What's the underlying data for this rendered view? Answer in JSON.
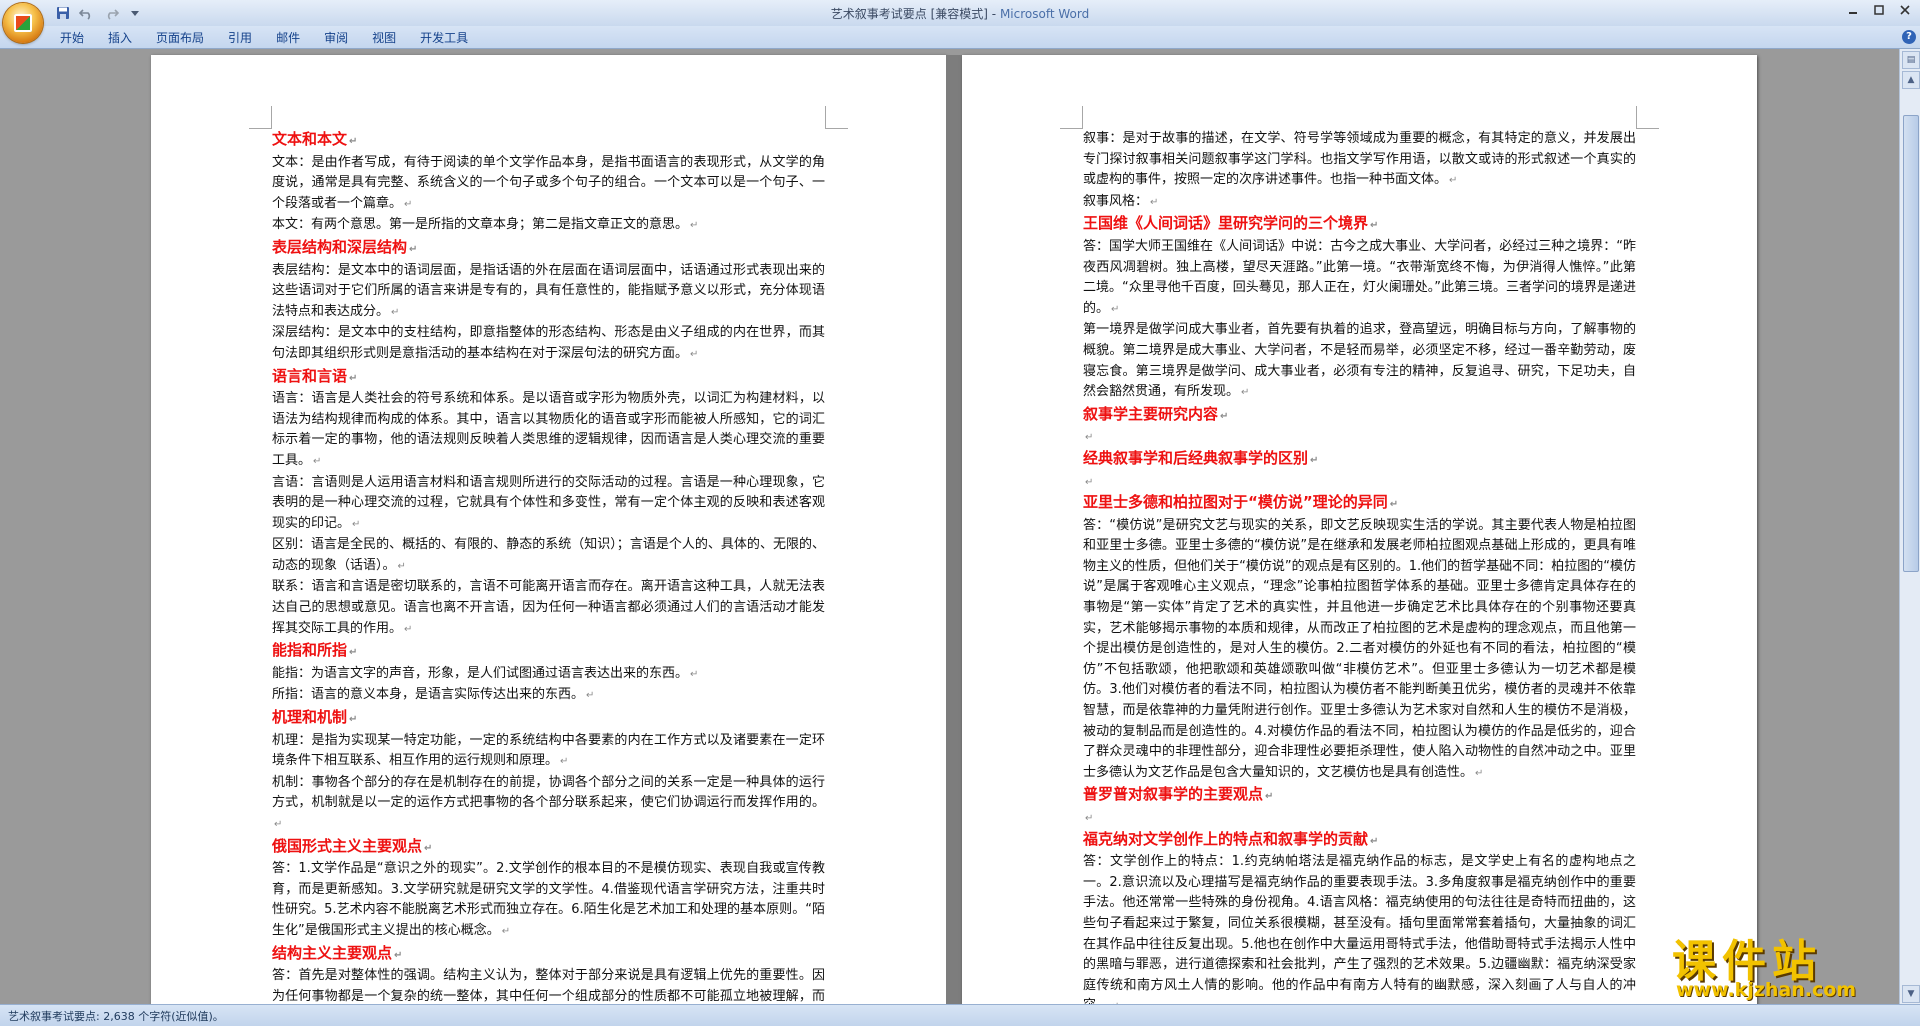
{
  "window": {
    "title": "艺术叙事考试要点 [兼容模式]",
    "separator": " - ",
    "app": "Microsoft Word"
  },
  "ribbon": {
    "tabs": [
      "开始",
      "插入",
      "页面布局",
      "引用",
      "邮件",
      "审阅",
      "视图",
      "开发工具"
    ]
  },
  "colors": {
    "heading": "#ee1111",
    "ribbon_text": "#15428b"
  },
  "icons": [
    "office-button-icon",
    "save-icon",
    "undo-icon",
    "redo-icon",
    "customize-qat-icon",
    "minimize-icon",
    "maximize-icon",
    "close-icon",
    "help-icon"
  ],
  "status": {
    "text": "艺术叙事考试要点: 2,638 个字符(近似值)。"
  },
  "watermark": {
    "title": "课件站",
    "url": "www.kjzhan.com"
  },
  "page1": [
    {
      "h": "文本和本文"
    },
    {
      "p": "文本：是由作者写成，有待于阅读的单个文学作品本身，是指书面语言的表现形式，从文学的角度说，通常是具有完整、系统含义的一个句子或多个句子的组合。一个文本可以是一个句子、一个段落或者一个篇章。"
    },
    {
      "p": "本文：有两个意思。第一是所指的文章本身；第二是指文章正文的意思。"
    },
    {
      "h": "表层结构和深层结构"
    },
    {
      "p": "表层结构：是文本中的语词层面，是指话语的外在层面在语词层面中，话语通过形式表现出来的这些语词对于它们所属的语言来讲是专有的，具有任意性的，能指赋予意义以形式，充分体现语法特点和表达成分。"
    },
    {
      "p": "深层结构：是文本中的支柱结构，即意指整体的形态结构、形态是由义子组成的内在世界，而其句法即其组织形式则是意指活动的基本结构在对于深层句法的研究方面。"
    },
    {
      "h": "语言和言语"
    },
    {
      "p": "语言：语言是人类社会的符号系统和体系。是以语音或字形为物质外壳，以词汇为构建材料，以语法为结构规律而构成的体系。其中，语言以其物质化的语音或字形而能被人所感知，它的词汇标示着一定的事物，他的语法规则反映着人类思维的逻辑规律，因而语言是人类心理交流的重要工具。"
    },
    {
      "p": "言语：言语则是人运用语言材料和语言规则所进行的交际活动的过程。言语是一种心理现象，它表明的是一种心理交流的过程，它就具有个体性和多变性，常有一定个体主观的反映和表述客观现实的印记。"
    },
    {
      "p": "区别：语言是全民的、概括的、有限的、静态的系统（知识）；言语是个人的、具体的、无限的、动态的现象（话语）。"
    },
    {
      "p": "联系：语言和言语是密切联系的，言语不可能离开语言而存在。离开语言这种工具，人就无法表达自己的思想或意见。语言也离不开言语，因为任何一种语言都必须通过人们的言语活动才能发挥其交际工具的作用。"
    },
    {
      "h": "能指和所指"
    },
    {
      "p": "能指：为语言文字的声音，形象，是人们试图通过语言表达出来的东西。"
    },
    {
      "p": "所指：语言的意义本身，是语言实际传达出来的东西。"
    },
    {
      "h": "机理和机制"
    },
    {
      "p": "机理：是指为实现某一特定功能，一定的系统结构中各要素的内在工作方式以及诸要素在一定环境条件下相互联系、相互作用的运行规则和原理。"
    },
    {
      "p": "机制：事物各个部分的存在是机制存在的前提，协调各个部分之间的关系一定是一种具体的运行方式，机制就是以一定的运作方式把事物的各个部分联系起来，使它们协调运行而发挥作用的。"
    },
    {
      "h": "俄国形式主义主要观点"
    },
    {
      "p": "答：1.文学作品是“意识之外的现实”。2.文学创作的根本目的不是模仿现实、表现自我或宣传教育，而是更新感知。3.文学研究就是研究文学的文学性。4.借鉴现代语言学研究方法，注重共时性研究。5.艺术内容不能脱离艺术形式而独立存在。6.陌生化是艺术加工和处理的基本原则。“陌生化”是俄国形式主义提出的核心概念。"
    },
    {
      "h": "结构主义主要观点"
    },
    {
      "p": "答：首先是对整体性的强调。结构主义认为，整体对于部分来说是具有逻辑上优先的重要性。因为任何事物都是一个复杂的统一整体，其中任何一个组成部分的性质都不可能孤立地被理解，而只能把它放在一个整体的关系网络中，即把它与其它部分联系起来才能被理解。结构主义方法的另一个主要观点是对共时性的强调。"
    }
  ],
  "page2": [
    {
      "p": "叙事：是对于故事的描述，在文学、符号学等领域成为重要的概念，有其特定的意义，并发展出专门探讨叙事相关问题叙事学这门学科。也指文学写作用语，以散文或诗的形式叙述一个真实的或虚构的事件，按照一定的次序讲述事件。也指一种书面文体。"
    },
    {
      "p": "叙事风格："
    },
    {
      "h": "王国维《人间词话》里研究学问的三个境界"
    },
    {
      "p": "答：国学大师王国维在《人间词话》中说：古今之成大事业、大学问者，必经过三种之境界：“昨夜西风凋碧树。独上高楼，望尽天涯路。”此第一境。“衣带渐宽终不悔，为伊消得人憔悴。”此第二境。“众里寻他千百度，回头蓦见，那人正在，灯火阑珊处。”此第三境。三者学问的境界是递进的。"
    },
    {
      "p": "第一境界是做学问成大事业者，首先要有执着的追求，登高望远，明确目标与方向，了解事物的概貌。第二境界是成大事业、大学问者，不是轻而易举，必须坚定不移，经过一番辛勤劳动，废寝忘食。第三境界是做学问、成大事业者，必须有专注的精神，反复追寻、研究，下足功夫，自然会豁然贯通，有所发现。"
    },
    {
      "h": "叙事学主要研究内容"
    },
    {
      "blank": true
    },
    {
      "h": "经典叙事学和后经典叙事学的区别"
    },
    {
      "blank": true
    },
    {
      "h": "亚里士多德和柏拉图对于“模仿说”理论的异同"
    },
    {
      "p": "答：“模仿说”是研究文艺与现实的关系，即文艺反映现实生活的学说。其主要代表人物是柏拉图和亚里士多德。亚里士多德的“模仿说”是在继承和发展老师柏拉图观点基础上形成的，更具有唯物主义的性质，但他们关于“模仿说”的观点是有区别的。1.他们的哲学基础不同：柏拉图的“模仿说”是属于客观唯心主义观点，“理念”论事柏拉图哲学体系的基础。亚里士多德肯定具体存在的事物是“第一实体”肯定了艺术的真实性，并且他进一步确定艺术比具体存在的个别事物还要真实，艺术能够揭示事物的本质和规律，从而改正了柏拉图的艺术是虚构的理念观点，而且他第一个提出模仿是创造性的，是对人生的模仿。2.二者对模仿的外延也有不同的看法，柏拉图的“模仿”不包括歌颂，他把歌颂和英雄颂歌叫做“非模仿艺术”。但亚里士多德认为一切艺术都是模仿。3.他们对模仿者的看法不同，柏拉图认为模仿者不能判断美丑优劣，模仿者的灵魂并不依靠智慧，而是依靠神的力量凭附进行创作。亚里士多德认为艺术家对自然和人生的模仿不是消极，被动的复制品而是创造性的。4.对模仿作品的看法不同，柏拉图认为模仿的作品是低劣的，迎合了群众灵魂中的非理性部分，迎合非理性必要拒杀理性，使人陷入动物性的自然冲动之中。亚里士多德认为文艺作品是包含大量知识的，文艺模仿也是具有创造性。"
    },
    {
      "h": "普罗普对叙事学的主要观点"
    },
    {
      "blank": true
    },
    {
      "h": "福克纳对文学创作上的特点和叙事学的贡献"
    },
    {
      "p": "答：文学创作上的特点：1.约克纳帕塔法是福克纳作品的标志，是文学史上有名的虚构地点之一。2.意识流以及心理描写是福克纳作品的重要表现手法。3.多角度叙事是福克纳创作中的重要手法。他还常常一些特殊的身份视角。4.语言风格：福克纳使用的句法往往是奇特而扭曲的，这些句子看起来过于繁复，同位关系很模糊，甚至没有。插句里面常常套着插句，大量抽象的词汇在其作品中往往反复出现。5.他也在创作中大量运用哥特式手法，他借助哥特式手法揭示人性中的黑暗与罪恶，进行道德探索和社会批判，产生了强烈的艺术效果。5.边疆幽默：福克纳深受家庭传统和南方风土人情的影响。他的作品中有南方人特有的幽默感，深入刻画了人与自人的冲突。"
    }
  ]
}
